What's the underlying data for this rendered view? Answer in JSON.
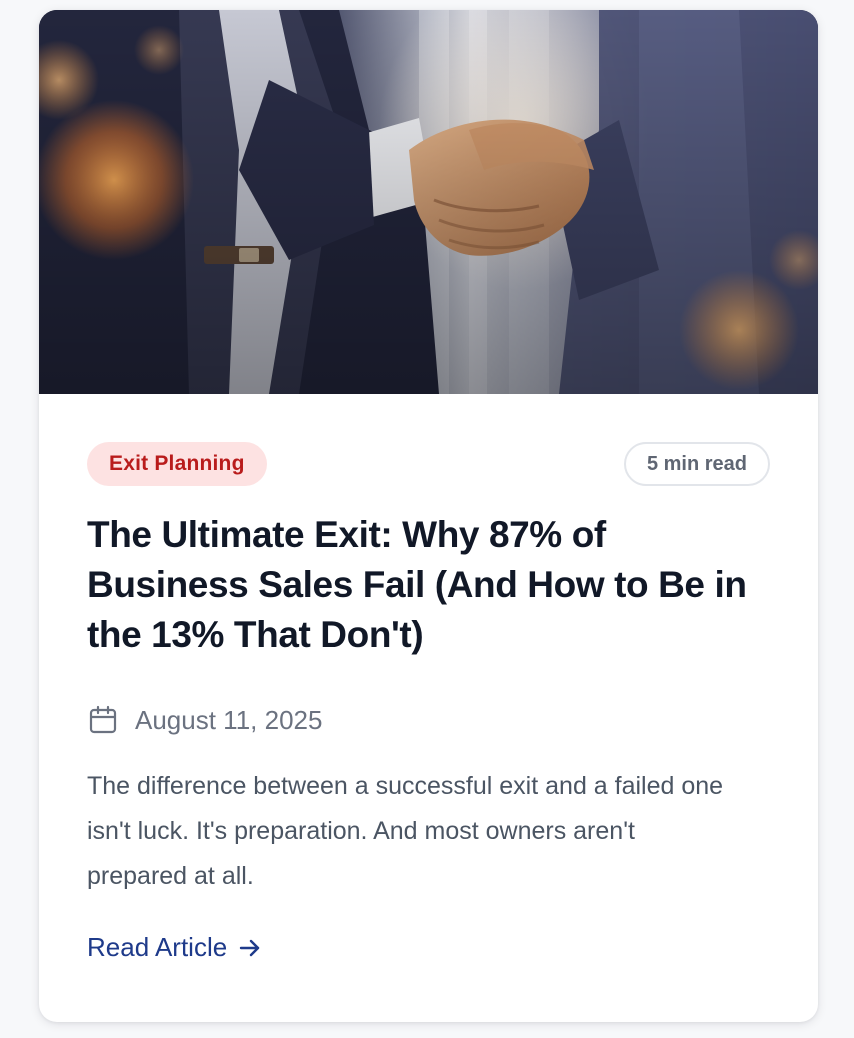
{
  "article": {
    "category": "Exit Planning",
    "read_time": "5 min read",
    "title": "The Ultimate Exit: Why 87% of Business Sales Fail (And How to Be in the 13% That Don't)",
    "date": "August 11, 2025",
    "excerpt": "The difference between a successful exit and a failed one isn't luck. It's preparation. And most owners aren't prepared at all.",
    "cta_label": "Read Article"
  },
  "icons": {
    "date": "calendar-icon",
    "cta": "arrow-right-icon"
  },
  "colors": {
    "badge_bg": "#fde2e2",
    "badge_text": "#b91c1c",
    "title": "#111827",
    "link": "#1e3a8a",
    "muted": "#6b7280"
  }
}
